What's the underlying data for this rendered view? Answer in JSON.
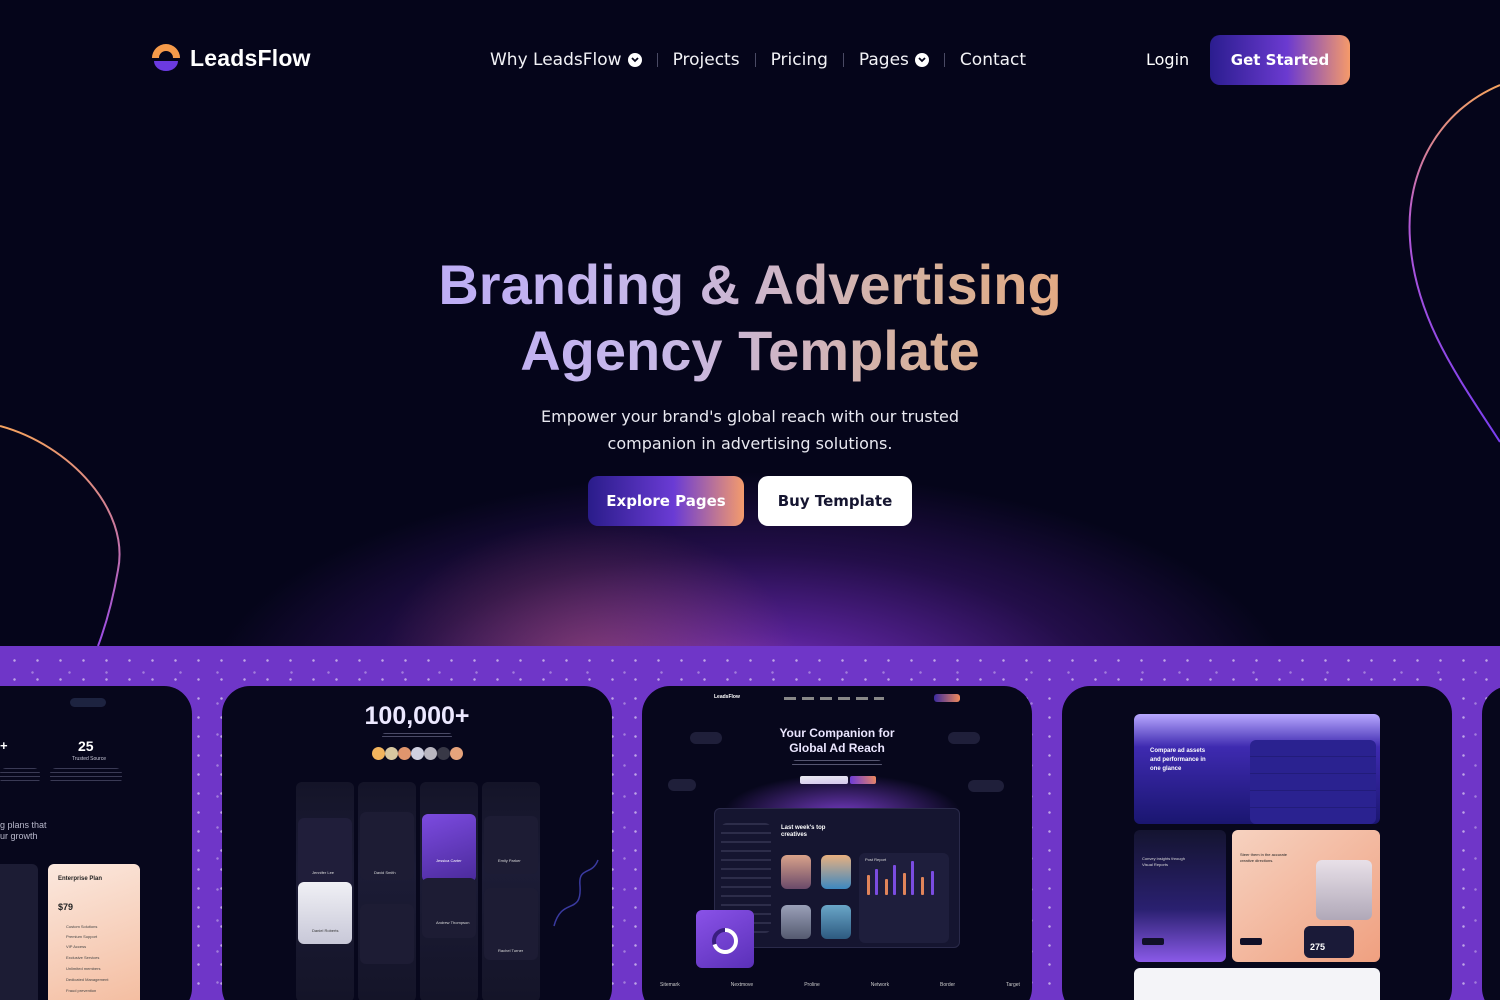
{
  "brand": {
    "name": "LeadsFlow"
  },
  "nav": {
    "items": [
      {
        "label": "Why LeadsFlow",
        "has_dropdown": true
      },
      {
        "label": "Projects",
        "has_dropdown": false
      },
      {
        "label": "Pricing",
        "has_dropdown": false
      },
      {
        "label": "Pages",
        "has_dropdown": true
      },
      {
        "label": "Contact",
        "has_dropdown": false
      }
    ],
    "login_label": "Login",
    "cta_label": "Get Started"
  },
  "hero": {
    "headline_line1": "Branding & Advertising",
    "headline_line2": "Agency Template",
    "subtext_line1": "Empower your brand's global reach with our trusted",
    "subtext_line2": "companion in advertising solutions.",
    "primary_button": "Explore Pages",
    "secondary_button": "Buy Template"
  },
  "showcase": {
    "card1": {
      "stat_value": "25",
      "stat_label": "Trusted Source",
      "side_heading_1": "g plans that",
      "side_heading_2": "ur growth",
      "plan_name": "Enterprise Plan",
      "plan_price": "$79",
      "plan_features": [
        "Custom Solutions",
        "Premium Support",
        "VIP Access",
        "Exclusive Services",
        "Unlimited members",
        "Dedicated Management",
        "Fraud prevention"
      ]
    },
    "card2": {
      "stat_value": "100,000+",
      "testimonial_names": [
        "Jennifer Lee",
        "David Smith",
        "Jessica Carter",
        "Emily Parker",
        "Daniel Roberts",
        "Andrew Thompson",
        "Rachel Turner",
        "Olivia Garcia"
      ]
    },
    "card3": {
      "logo": "LeadsFlow",
      "headline_line1": "Your Companion for",
      "headline_line2": "Global Ad Reach",
      "dashboard_title_1": "Last week's top",
      "dashboard_title_2": "creatives",
      "report_label": "Post Report",
      "partner_logos": [
        "Sitemark",
        "Nextmove",
        "Proline",
        "Network",
        "Border",
        "Target"
      ]
    },
    "card4": {
      "panel1_title_1": "Compare ad assets",
      "panel1_title_2": "and performance in",
      "panel1_title_3": "one glance",
      "panel2_title_1": "Convey insights through",
      "panel2_title_2": "Visual Reports",
      "panel3_title_1": "Steer them in the accurate",
      "panel3_title_2": "creative directions.",
      "panel3_value": "275"
    }
  },
  "colors": {
    "background": "#05051a",
    "accent_purple": "#6f36c8",
    "accent_orange": "#f59a6a",
    "button_deep": "#2b1d8f"
  }
}
